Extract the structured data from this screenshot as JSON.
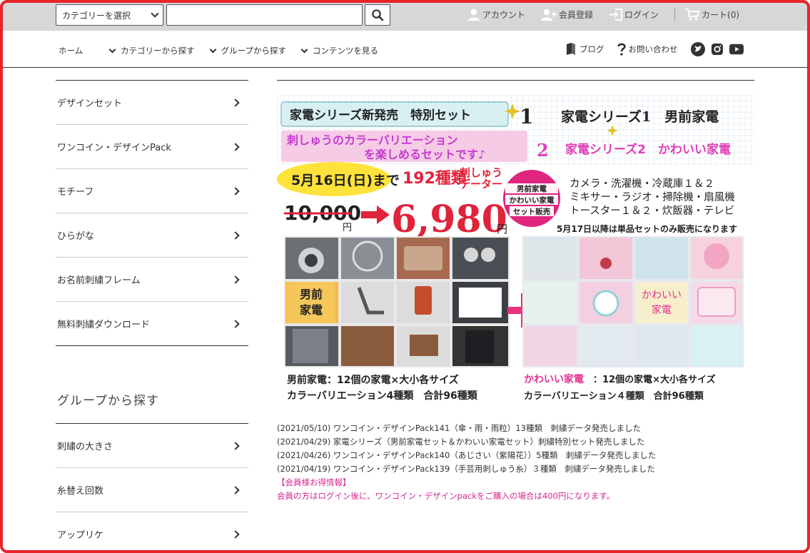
{
  "topbar": {
    "category_select": "カテゴリーを選択",
    "search_placeholder": "",
    "account": "アカウント",
    "register": "会員登録",
    "login": "ログイン",
    "cart": "カート(0)"
  },
  "nav": {
    "home": "ホーム",
    "items": [
      "カテゴリーから探す",
      "グループから探す",
      "コンテンツを見る"
    ],
    "blog": "ブログ",
    "contact": "お問い合わせ",
    "social_icons": [
      "twitter-icon",
      "instagram-icon",
      "youtube-icon"
    ]
  },
  "sidebar": {
    "categories": [
      "デザインセット",
      "ワンコイン・デザインPack",
      "モチーフ",
      "ひらがな",
      "お名前刺繍フレーム",
      "無料刺繍ダウンロード"
    ],
    "group_heading": "グループから探す",
    "groups": [
      "刺繍の大きさ",
      "糸替え回数",
      "アップリケ"
    ]
  },
  "banner": {
    "title1": "家電シリーズ新発売　特別セット",
    "num1": "1",
    "series1": "家電シリーズ1　男前家電",
    "subtitle_line1": "刺しゅうのカラーバリエーション",
    "subtitle_line2": "を楽しめるセットです♪",
    "num2": "2",
    "series2": "家電シリーズ2　かわいい家電",
    "deadline": "5月16日(日)まで",
    "kinds": "192種類",
    "kinds_suffix1": "刺しゅう",
    "kinds_suffix2": "データー",
    "old_price": "10,000",
    "yen": "円",
    "new_price": "6,980",
    "badge_line1": "男前家電",
    "badge_line2": "かわいい家電",
    "badge_line3": "セット販売",
    "items_line1": "カメラ・洗濯機・冷蔵庫１＆２",
    "items_line2": "ミキサー・ラジオ・掃除機・扇風機",
    "items_line3": "トースター１＆２・炊飯器・テレビ",
    "notice": "5月17日以降は単品セットのみ販売になります",
    "label_otokomae_1": "男前",
    "label_otokomae_2": "家電",
    "label_kawaii_1": "かわいい",
    "label_kawaii_2": "家電",
    "bottom_left_1": "男前家電：12個の家電×大小各サイズ",
    "bottom_left_2": "カラーバリエーション4種類　合計96種類",
    "bottom_right_1a": "かわいい家電",
    "bottom_right_1b": "：12個の家電×大小各サイズ",
    "bottom_right_2": "カラーバリエーション４種類　合計96種類"
  },
  "news": [
    {
      "date": "(2021/05/10)",
      "text": "ワンコイン・デザインPack141（傘・雨・雨粒）13種類　刺繍データ発売しました"
    },
    {
      "date": "(2021/04/29)",
      "text": "家電シリーズ（男前家電セット＆かわいい家電セット）刺繍特別セット発売しました"
    },
    {
      "date": "(2021/04/26)",
      "text": "ワンコイン・デザインPack140（あじさい（紫陽花））5種類　刺繍データ発売しました"
    },
    {
      "date": "(2021/04/19)",
      "text": "ワンコイン・デザインPack139（手芸用刺しゅう糸）３種類　刺繍データ発売しました"
    }
  ],
  "member_info": {
    "heading": "【会員様お得情報】",
    "text": "会員の方はログイン後に、ワンコイン・デザインpackをご購入の場合は400円になります。"
  },
  "colors": {
    "frame": "#e5252a",
    "topbar": "#d7d7d7",
    "pink": "#d6288f",
    "banner_red": "#e0233b",
    "banner_yellow": "#ffe23a"
  }
}
